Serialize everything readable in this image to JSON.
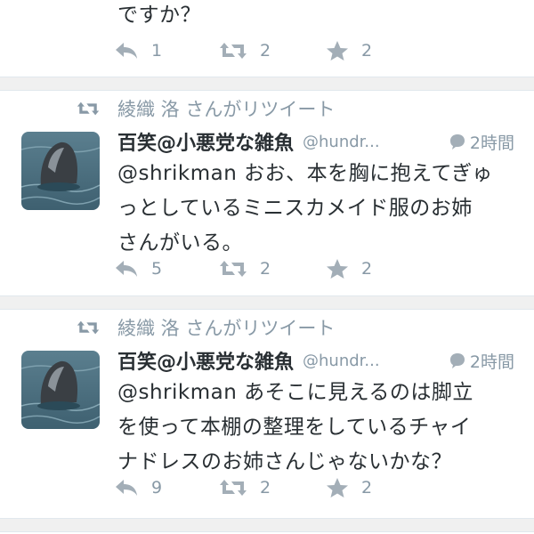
{
  "tweets": [
    {
      "text": "ですか？",
      "reply_count": "1",
      "retweet_count": "2",
      "favorite_count": "2"
    },
    {
      "retweeted_by": "綾織 洛 さんがリツイート",
      "name": "百笑@小悪党な雑魚",
      "handle": "@hundr...",
      "time": "2時間",
      "text_lines": [
        "@shrikman おお、本を胸に抱えてぎゅ",
        "っとしているミニスカメイド服のお姉",
        "さんがいる。"
      ],
      "reply_count": "5",
      "retweet_count": "2",
      "favorite_count": "2"
    },
    {
      "retweeted_by": "綾織 洛 さんがリツイート",
      "name": "百笑@小悪党な雑魚",
      "handle": "@hundr...",
      "time": "2時間",
      "text_lines": [
        "@shrikman あそこに見えるのは脚立",
        "を使って本棚の整理をしているチャイ",
        "ナドレスのお姉さんじゃないかな？"
      ],
      "reply_count": "9",
      "retweet_count": "2",
      "favorite_count": "2"
    }
  ],
  "colors": {
    "muted": "#8899a6",
    "text": "#292f33",
    "divider": "#f0f0f0"
  }
}
